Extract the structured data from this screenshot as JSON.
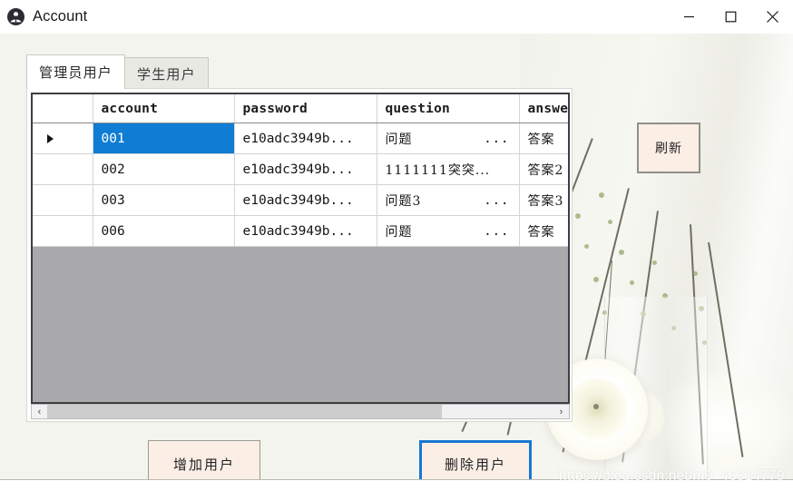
{
  "window": {
    "title": "Account",
    "icon": "user-circle-icon",
    "controls": {
      "minimize": "minimize-icon",
      "maximize": "maximize-icon",
      "close": "close-icon"
    }
  },
  "tabs": [
    {
      "label": "管理员用户",
      "active": true
    },
    {
      "label": "学生用户",
      "active": false
    }
  ],
  "grid": {
    "columns": [
      "",
      "account",
      "password",
      "question",
      "answer"
    ],
    "rows": [
      {
        "marker": "▶",
        "selected": true,
        "account": "001",
        "password": "e10adc3949b...",
        "question": "问题",
        "question_dots": "...",
        "answer": "答案"
      },
      {
        "marker": "",
        "selected": false,
        "account": "002",
        "password": "e10adc3949b...",
        "question": "1111111突突...",
        "question_dots": "",
        "answer": "答案2"
      },
      {
        "marker": "",
        "selected": false,
        "account": "003",
        "password": "e10adc3949b...",
        "question": "问题3",
        "question_dots": "...",
        "answer": "答案3"
      },
      {
        "marker": "",
        "selected": false,
        "account": "006",
        "password": "e10adc3949b...",
        "question": "问题",
        "question_dots": "...",
        "answer": "答案"
      }
    ],
    "scrollbar": {
      "left_arrow": "‹",
      "right_arrow": "›",
      "thumb_percent": 78
    }
  },
  "buttons": {
    "add_user": "增加用户",
    "delete_user": "删除用户",
    "refresh": "刷新"
  },
  "watermark": "https://blog.csdn.net/m0_46314779",
  "colors": {
    "selection_blue": "#0f7dd4",
    "focus_border_blue": "#1878d2",
    "button_face": "#fbeee4",
    "grid_empty_gray": "#a9a9ac",
    "client_background": "#f4f4ee"
  }
}
